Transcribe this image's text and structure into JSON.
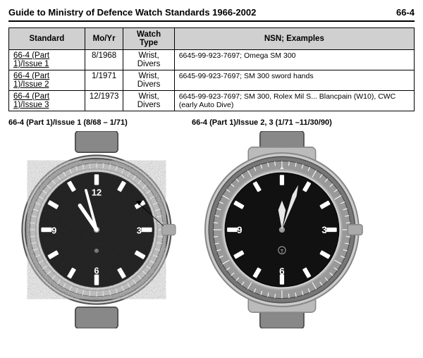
{
  "header": {
    "title": "Guide to Ministry of Defence Watch Standards 1966-2002",
    "page_number": "66-4"
  },
  "table": {
    "columns": [
      "Standard",
      "Mo/Yr",
      "Watch Type",
      "NSN; Examples"
    ],
    "rows": [
      {
        "standard": "66-4 (Part 1)/Issue 1",
        "mo_yr": "8/1968",
        "watch_type": "Wrist, Divers",
        "nsn_examples": "6645-99-923-7697; Omega SM 300"
      },
      {
        "standard": "66-4 (Part 1)/Issue 2",
        "mo_yr": "1/1971",
        "watch_type": "Wrist, Divers",
        "nsn_examples": "6645-99-923-7697; SM 300 sword hands"
      },
      {
        "standard": "66-4 (Part 1)/Issue 3",
        "mo_yr": "12/1973",
        "watch_type": "Wrist, Divers",
        "nsn_examples": "6645-99-923-7697; SM 300, Rolex Mil S... Blancpain (W10), CWC (early Auto Dive)"
      }
    ]
  },
  "watch_sections": [
    {
      "label": "66-4 (Part 1)/Issue 1 (8/68 – 1/71)",
      "id": "watch1"
    },
    {
      "label": "66-4 (Part 1)/Issue 2, 3 (1/71 –11/30/90)",
      "id": "watch2"
    }
  ]
}
